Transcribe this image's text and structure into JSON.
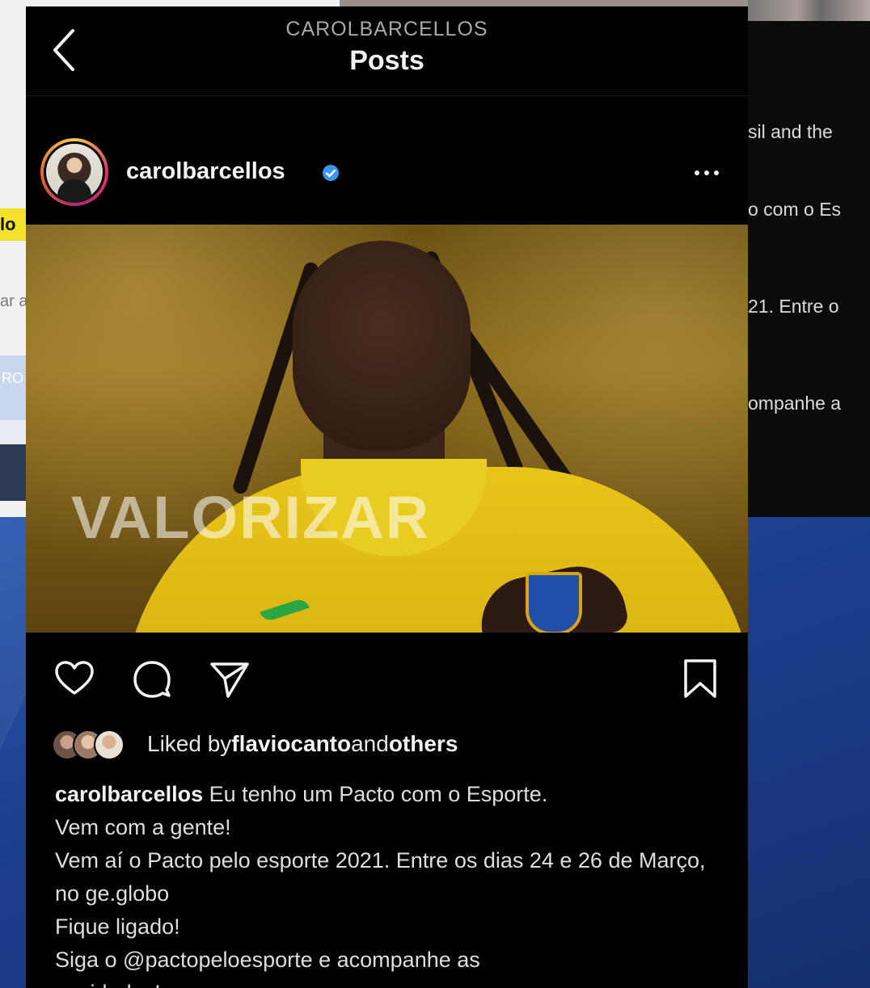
{
  "header": {
    "account": "CAROLBARCELLOS",
    "title": "Posts"
  },
  "post": {
    "username": "carolbarcellos",
    "media_watermark": "VALORIZAR",
    "liked_by_prefix": "Liked by ",
    "liked_by_user": "flaviocanto",
    "liked_by_and": " and ",
    "liked_by_others": "others",
    "caption_user": "carolbarcellos",
    "caption_lines": [
      " Eu tenho um Pacto com o Esporte.",
      "Vem com a gente!",
      "Vem aí o Pacto pelo esporte 2021. Entre os dias 24 e 26 de Março, no ge.globo",
      "Fique ligado!",
      "Siga o @pactopeloesporte e acompanhe as",
      "novidades!"
    ]
  },
  "background": {
    "left_highlight": "lo",
    "left_fragment": "ar a",
    "left_card_label": "RO",
    "right_lines": [
      "sil and the",
      "o com o Es",
      "21. Entre o",
      "ompanhe a"
    ]
  },
  "colors": {
    "verified": "#3897f0",
    "background_blue": "#1d3f8a",
    "panel": "#000000"
  },
  "icons": [
    "back-chevron-icon",
    "verified-badge-icon",
    "more-options-icon",
    "heart-icon",
    "comment-icon",
    "share-icon",
    "bookmark-icon"
  ]
}
